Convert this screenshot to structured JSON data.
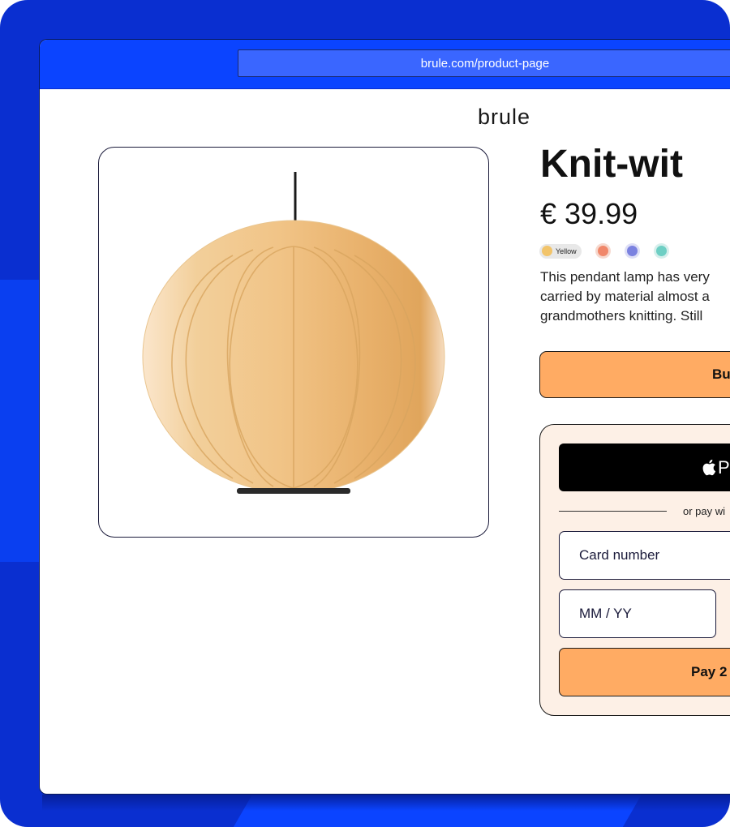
{
  "browser": {
    "url": "brule.com/product-page"
  },
  "brand": {
    "logo": "brule"
  },
  "product": {
    "title": "Knit-wit",
    "price": "€ 39.99",
    "description_lines": [
      "This pendant lamp has very",
      "carried by material almost a",
      "grandmothers knitting. Still"
    ],
    "image_icon": "pendant-lamp-illustration"
  },
  "colors": {
    "selected_label": "Yellow",
    "options": [
      {
        "name": "Yellow",
        "hex": "#f2c46a"
      },
      {
        "name": "orange",
        "hex": "#f0876a"
      },
      {
        "name": "blue",
        "hex": "#7b82e0"
      },
      {
        "name": "teal",
        "hex": "#6ecfc4"
      }
    ]
  },
  "actions": {
    "buy_label": "Bu",
    "apple_pay_label": "P",
    "or_pay_label": "or pay wi",
    "card_placeholder": "Card number",
    "expiry_placeholder": "MM / YY",
    "pay_label": "Pay 2"
  },
  "theme": {
    "accent": "#ffab63",
    "frame_blue": "#0a2fd0",
    "bar_blue": "#0b44ff",
    "panel_bg": "#fdf0e6"
  }
}
